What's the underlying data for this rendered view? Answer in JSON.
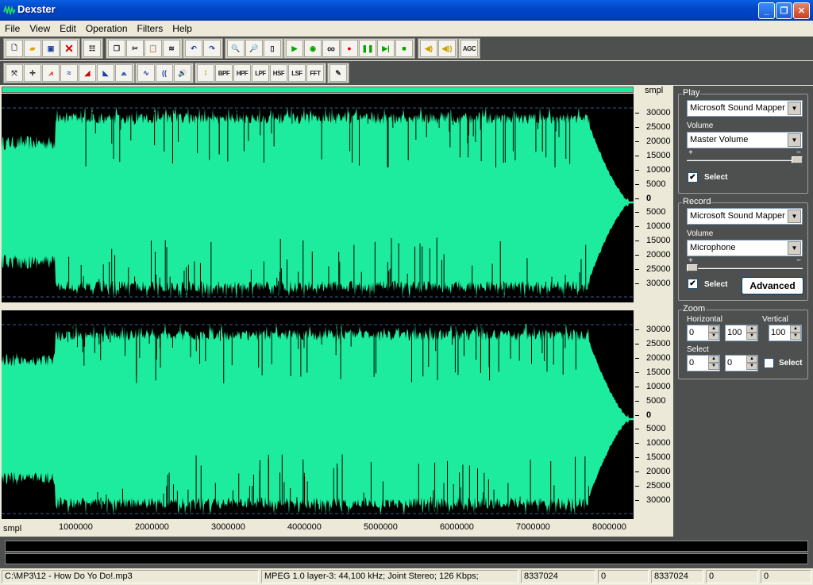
{
  "window": {
    "title": "Dexster"
  },
  "menu": [
    "File",
    "View",
    "Edit",
    "Operation",
    "Filters",
    "Help"
  ],
  "toolbar1": {
    "groups": [
      [
        "new-icon",
        "open-icon",
        "save-icon",
        "delete-icon"
      ],
      [
        "properties-icon"
      ],
      [
        "copy-icon",
        "cut-icon",
        "paste-icon",
        "mix-paste-icon"
      ],
      [
        "undo-icon",
        "redo-icon"
      ],
      [
        "zoom-in-icon",
        "zoom-out-icon",
        "zoom-full-icon"
      ],
      [
        "play-icon",
        "play-selection-icon",
        "loop-icon",
        "record-icon",
        "pause-icon",
        "play-next-icon",
        "stop-icon"
      ],
      [
        "volume-down-icon",
        "volume-up-icon"
      ],
      [
        "agc-icon"
      ]
    ],
    "agc_label": "AGC"
  },
  "toolbar2": {
    "groups": [
      [
        "stretch-icon",
        "center-icon",
        "noise-icon",
        "normalize-icon",
        "fade-in-icon",
        "fade-out-icon",
        "echo-icon"
      ],
      [
        "reverse-icon",
        "delay-icon",
        "speaker-icon"
      ],
      [
        "eq-icon",
        "bpf-icon",
        "hpf-icon",
        "lpf-icon",
        "hsf-icon",
        "lsf-icon",
        "fft-icon"
      ],
      [
        "tools-icon"
      ]
    ],
    "filter_labels": [
      "BPF",
      "HPF",
      "LPF",
      "HSF",
      "LSF",
      "FFT"
    ]
  },
  "waveform": {
    "unit_label": "smpl",
    "x_unit_label": "smpl",
    "y_ticks": [
      "30000",
      "25000",
      "20000",
      "15000",
      "10000",
      "5000",
      "0",
      "5000",
      "10000",
      "15000",
      "20000",
      "25000",
      "30000"
    ],
    "x_ticks": [
      "1000000",
      "2000000",
      "3000000",
      "4000000",
      "5000000",
      "6000000",
      "7000000",
      "8000000"
    ],
    "total_samples": 8337024,
    "colors": {
      "wave": "#1deb9d",
      "background": "#000000"
    }
  },
  "panel": {
    "play": {
      "legend": "Play",
      "device": "Microsoft Sound Mapper",
      "volume_label": "Volume",
      "volume_source": "Master Volume",
      "plus": "+",
      "minus": "−",
      "level": 1.0,
      "select_label": "Select",
      "select_checked": "✔"
    },
    "record": {
      "legend": "Record",
      "device": "Microsoft Sound Mapper",
      "volume_label": "Volume",
      "volume_source": "Microphone",
      "plus": "+",
      "minus": "−",
      "level": 0.0,
      "select_label": "Select",
      "select_checked": "✔",
      "advanced_label": "Advanced"
    },
    "zoom": {
      "legend": "Zoom",
      "horizontal_label": "Horizontal",
      "vertical_label": "Vertical",
      "h_from": "0",
      "h_to": "100",
      "vertical": "100",
      "select_label": "Select",
      "sel_from": "0",
      "sel_to": "0",
      "select_check_label": "Select"
    }
  },
  "status": {
    "file": "C:\\MP3\\12 - How Do Yo Do!.mp3",
    "format": "MPEG 1.0 layer-3: 44,100 kHz; Joint Stereo; 126 Kbps;",
    "length": "8337024",
    "sel_start": "0",
    "sel_end": "8337024",
    "v1": "0",
    "v2": "0"
  }
}
